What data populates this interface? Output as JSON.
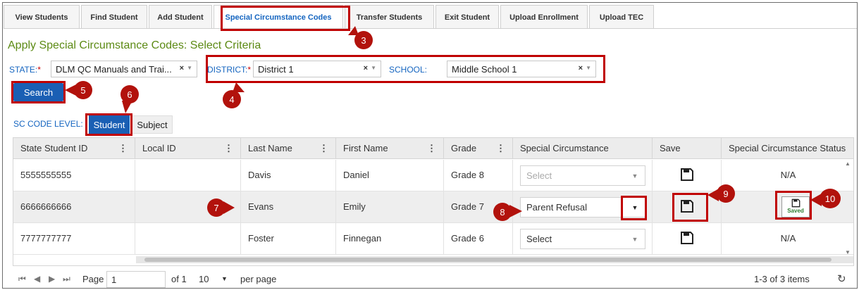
{
  "tabs": [
    {
      "label": "View Students"
    },
    {
      "label": "Find Student"
    },
    {
      "label": "Add Student"
    },
    {
      "label": "Special Circumstance Codes"
    },
    {
      "label": "Transfer Students"
    },
    {
      "label": "Exit Student"
    },
    {
      "label": "Upload Enrollment"
    },
    {
      "label": "Upload TEC"
    }
  ],
  "page_title": "Apply Special Circumstance Codes: Select Criteria",
  "criteria": {
    "state_label": "STATE:",
    "state_value": "DLM QC Manuals and Trai...",
    "district_label": "DISTRICT:",
    "district_value": "District 1",
    "school_label": "SCHOOL:",
    "school_value": "Middle School 1",
    "required_mark": "*",
    "clear_glyph": "×",
    "caret_glyph": "▼"
  },
  "search_label": "Search",
  "sc_level": {
    "label": "SC CODE LEVEL:",
    "options": [
      "Student",
      "Subject"
    ],
    "selected": "Student"
  },
  "grid": {
    "columns": [
      "State Student ID",
      "Local ID",
      "Last Name",
      "First Name",
      "Grade",
      "Special Circumstance",
      "Save",
      "Special Circumstance Status"
    ],
    "rows": [
      {
        "state_id": "5555555555",
        "local_id": "",
        "last": "Davis",
        "first": "Daniel",
        "grade": "Grade 8",
        "sc": "Select",
        "sc_disabled": true,
        "status": "N/A"
      },
      {
        "state_id": "6666666666",
        "local_id": "",
        "last": "Evans",
        "first": "Emily",
        "grade": "Grade 7",
        "sc": "Parent Refusal",
        "sc_disabled": false,
        "status": "Saved"
      },
      {
        "state_id": "7777777777",
        "local_id": "",
        "last": "Foster",
        "first": "Finnegan",
        "grade": "Grade 6",
        "sc": "Select",
        "sc_disabled": false,
        "status": "N/A"
      }
    ]
  },
  "pager": {
    "page_label": "Page",
    "page_value": "1",
    "of_label": "of 1",
    "page_size": "10",
    "per_page_label": "per page",
    "summary": "1-3 of 3 items"
  },
  "callouts": [
    "3",
    "4",
    "5",
    "6",
    "7",
    "8",
    "9",
    "10"
  ],
  "colors": {
    "accent": "#1a5fb4",
    "title_green": "#5c8a14",
    "callout_red": "#b2120c",
    "saved_green": "#2e7d32"
  }
}
